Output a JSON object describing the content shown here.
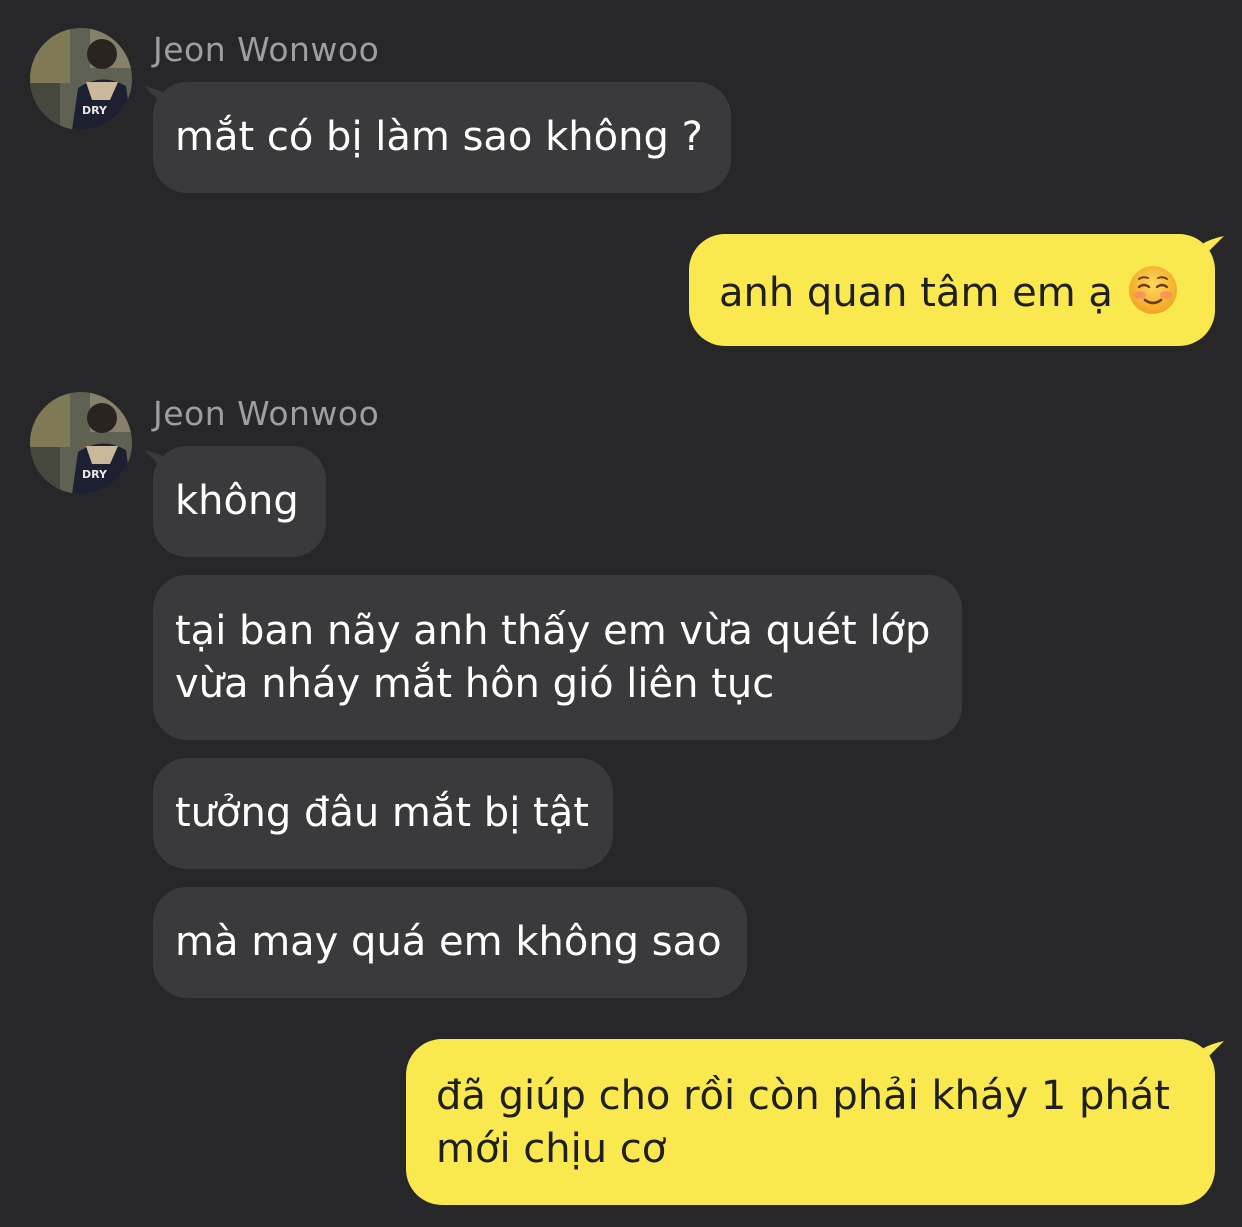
{
  "colors": {
    "background": "#272729",
    "incoming_bubble": "#3a3a3c",
    "outgoing_bubble": "#fae84f",
    "sender_name": "#9d9da2"
  },
  "messages": [
    {
      "sender": "Jeon Wonwoo",
      "direction": "incoming",
      "text": "mắt có bị làm sao không ?"
    },
    {
      "direction": "outgoing",
      "text": "anh quan tâm em ạ",
      "emoji": "smiling-face-with-blush-emoji"
    },
    {
      "sender": "Jeon Wonwoo",
      "direction": "incoming",
      "text": "không"
    },
    {
      "direction": "incoming",
      "lines": [
        "tại ban nãy anh thấy em vừa quét lớp",
        "vừa nháy mắt hôn gió liên tục"
      ]
    },
    {
      "direction": "incoming",
      "text": "tưởng đâu mắt bị tật"
    },
    {
      "direction": "incoming",
      "text": "mà may quá em không sao"
    },
    {
      "direction": "outgoing",
      "lines": [
        "đã giúp cho rồi còn phải kháy 1 phát",
        "mới chịu cơ"
      ]
    }
  ]
}
